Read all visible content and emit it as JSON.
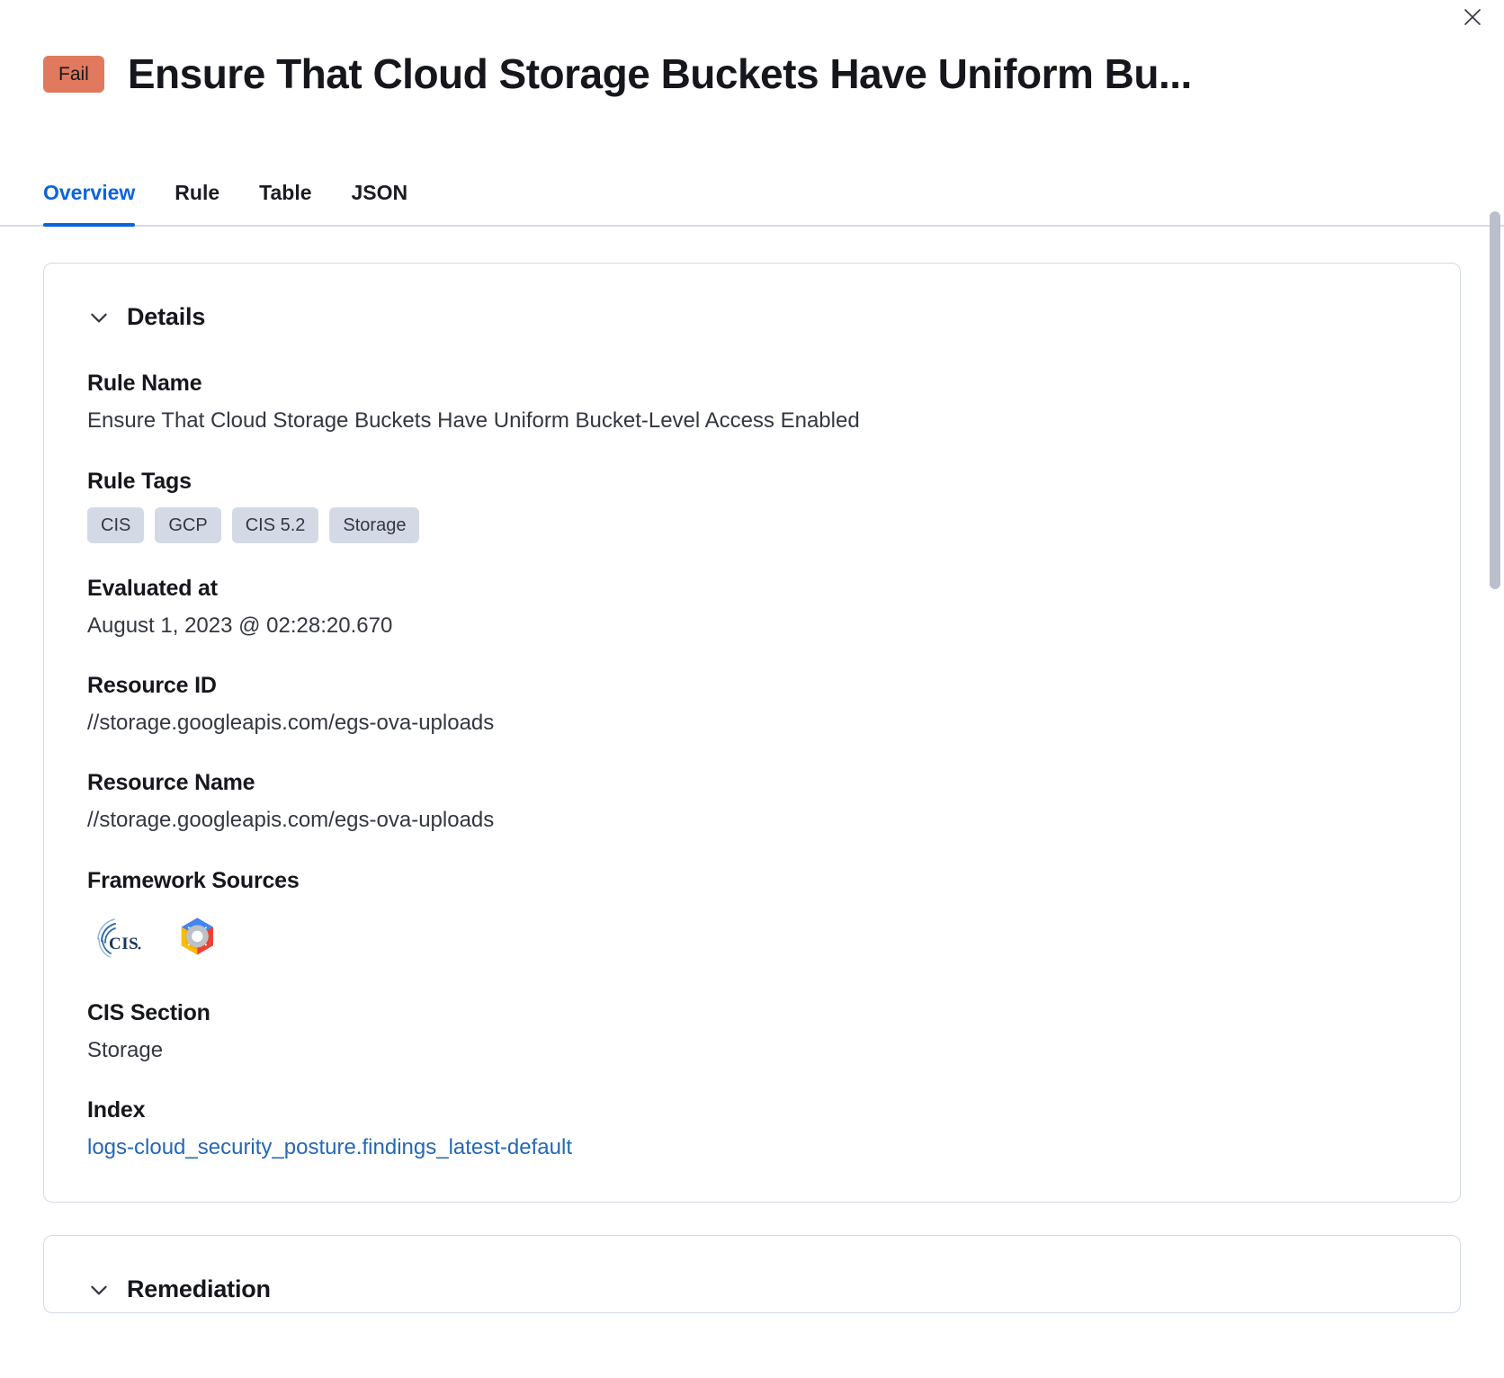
{
  "header": {
    "status_badge": "Fail",
    "title": "Ensure That Cloud Storage Buckets Have Uniform Bu...",
    "close_icon": "close-icon"
  },
  "tabs": [
    {
      "label": "Overview",
      "active": true
    },
    {
      "label": "Rule",
      "active": false
    },
    {
      "label": "Table",
      "active": false
    },
    {
      "label": "JSON",
      "active": false
    }
  ],
  "details": {
    "section_title": "Details",
    "rule_name_label": "Rule Name",
    "rule_name_value": "Ensure That Cloud Storage Buckets Have Uniform Bucket-Level Access Enabled",
    "rule_tags_label": "Rule Tags",
    "rule_tags": [
      "CIS",
      "GCP",
      "CIS 5.2",
      "Storage"
    ],
    "evaluated_at_label": "Evaluated at",
    "evaluated_at_value": "August 1, 2023 @ 02:28:20.670",
    "resource_id_label": "Resource ID",
    "resource_id_value": "//storage.googleapis.com/egs-ova-uploads",
    "resource_name_label": "Resource Name",
    "resource_name_value": "//storage.googleapis.com/egs-ova-uploads",
    "framework_sources_label": "Framework Sources",
    "framework_sources": [
      {
        "name": "cis-logo",
        "alt": "CIS"
      },
      {
        "name": "google-cloud-logo",
        "alt": "GCP"
      }
    ],
    "cis_section_label": "CIS Section",
    "cis_section_value": "Storage",
    "index_label": "Index",
    "index_value": "logs-cloud_security_posture.findings_latest-default"
  },
  "remediation": {
    "section_title": "Remediation"
  },
  "colors": {
    "fail_badge": "#e0795e",
    "accent_blue": "#0b64dd",
    "link_blue": "#2567b5",
    "tag_bg": "#d3dae6",
    "border": "#d3dae6",
    "text": "#1a1c21"
  }
}
